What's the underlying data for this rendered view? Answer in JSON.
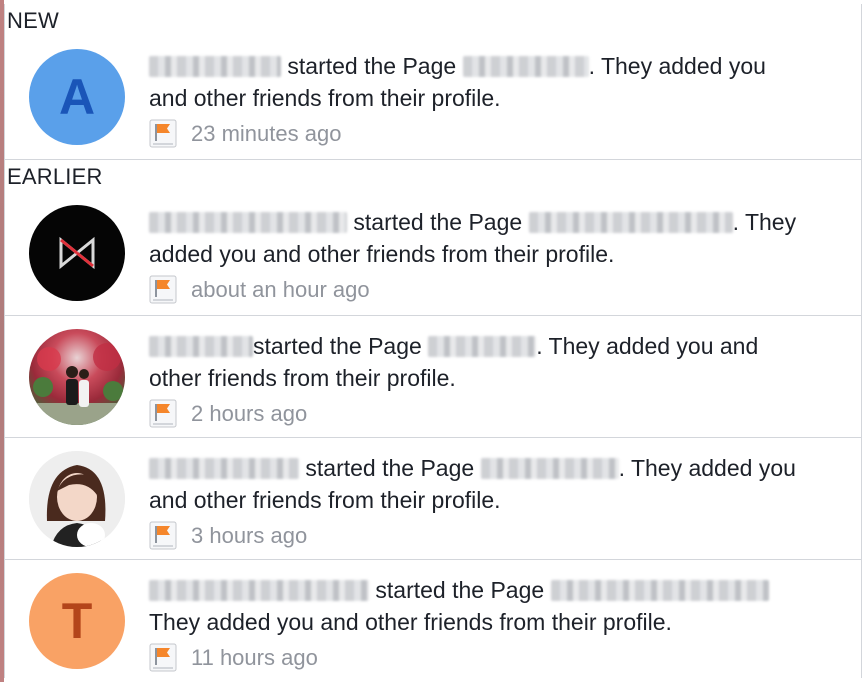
{
  "sections": {
    "new": {
      "label": "NEW",
      "items": [
        {
          "avatar_letter": "A",
          "avatar_bg": "#5aa0ea",
          "avatar_fg": "#1a55b8",
          "text_mid": "started the Page",
          "text_end": ". They added you and other friends from their profile.",
          "time": "23 minutes ago"
        }
      ]
    },
    "earlier": {
      "label": "EARLIER",
      "items": [
        {
          "avatar_type": "logo",
          "text_mid": "started the Page",
          "text_end": ". They added you and other friends from their profile.",
          "time": "about an hour ago"
        },
        {
          "avatar_type": "photo-garden",
          "text_mid": "started the Page",
          "text_end": ". They added you and other friends from their profile.",
          "time": "2 hours ago"
        },
        {
          "avatar_type": "photo-portrait",
          "text_mid": "started the Page",
          "text_end": ". They added you and other friends from their profile.",
          "time": "3 hours ago"
        },
        {
          "avatar_letter": "T",
          "avatar_bg": "#f9a265",
          "avatar_fg": "#b4451a",
          "text_mid": "started the Page",
          "text_end": "They added you and other friends from their profile.",
          "time": "11 hours ago"
        }
      ]
    }
  },
  "icons": {
    "notification_type": "page-flag-icon"
  },
  "colors": {
    "flag_orange": "#f5862b",
    "timestamp_gray": "#90949c",
    "divider": "#d3d6db"
  }
}
